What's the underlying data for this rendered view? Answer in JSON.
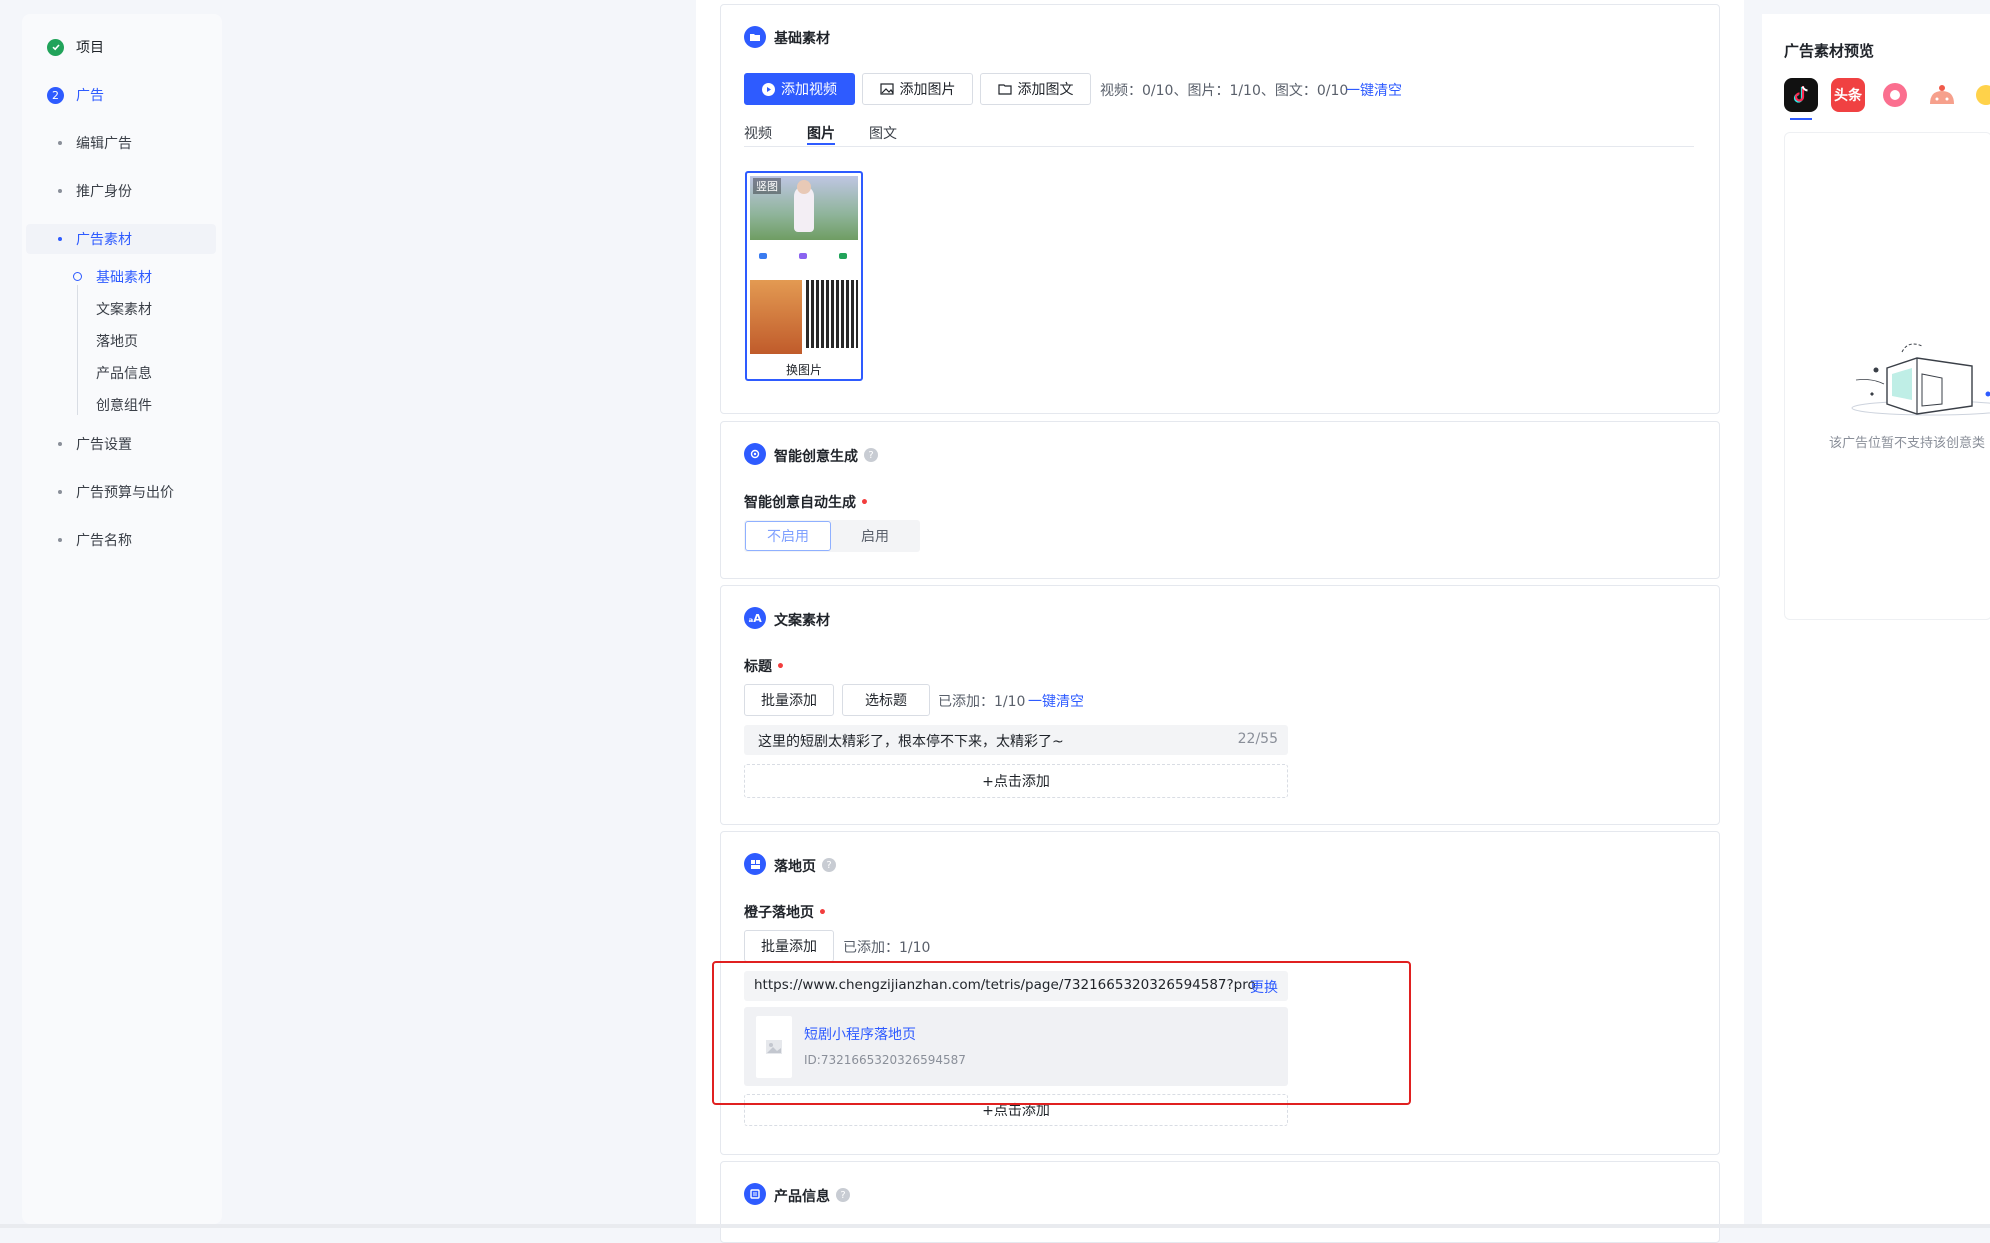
{
  "sidebar": {
    "steps": [
      {
        "label": "项目",
        "state": "done",
        "icon": "check-icon"
      },
      {
        "label": "广告",
        "state": "current",
        "number": "2"
      }
    ],
    "items": [
      {
        "label": "编辑广告"
      },
      {
        "label": "推广身份"
      },
      {
        "label": "广告素材",
        "active": true
      },
      {
        "label": "广告设置"
      },
      {
        "label": "广告预算与出价"
      },
      {
        "label": "广告名称"
      }
    ],
    "sub_items": [
      {
        "label": "基础素材",
        "active": true
      },
      {
        "label": "文案素材"
      },
      {
        "label": "落地页"
      },
      {
        "label": "产品信息"
      },
      {
        "label": "创意组件"
      }
    ]
  },
  "basic": {
    "title": "基础素材",
    "add_video": "添加视频",
    "add_image": "添加图片",
    "add_graphic": "添加图文",
    "counts": "视频：0/10、图片：1/10、图文：0/10",
    "clear": "一键清空",
    "tabs": [
      "视频",
      "图片",
      "图文"
    ],
    "active_tab": "图片",
    "thumb_tag": "竖图",
    "thumb_action": "换图片"
  },
  "smart": {
    "title": "智能创意生成",
    "field_label": "智能创意自动生成",
    "options": [
      "不启用",
      "启用"
    ],
    "selected": "不启用"
  },
  "copy": {
    "title": "文案素材",
    "field_label": "标题",
    "batch_add": "批量添加",
    "pick_title": "选标题",
    "added": "已添加：1/10",
    "clear": "一键清空",
    "title_text": "这里的短剧太精彩了，根本停不下来，太精彩了~",
    "title_count": "22/55",
    "add_more": "+点击添加"
  },
  "landing": {
    "title": "落地页",
    "field_label": "橙子落地页",
    "batch_add": "批量添加",
    "added": "已添加：1/10",
    "url": "https://www.chengzijianzhan.com/tetris/page/7321665320326594587?pro",
    "change": "更换",
    "page_name": "短剧小程序落地页",
    "page_id": "ID:7321665320326594587",
    "add_more": "+点击添加"
  },
  "product": {
    "title": "产品信息"
  },
  "preview": {
    "title": "广告素材预览",
    "apps": [
      {
        "icon": "douyin-icon",
        "label": "",
        "color": "#111111"
      },
      {
        "icon": "toutiao-icon",
        "label": "头条",
        "color": "#f04142"
      },
      {
        "icon": "pink-app-icon",
        "label": "",
        "color": "#fb6f8f"
      },
      {
        "icon": "fanqie-icon",
        "label": "",
        "color": "#f6a08c"
      },
      {
        "icon": "yellow-app-icon",
        "label": "",
        "color": "#ffd24a"
      }
    ],
    "empty_text": "该广告位暂不支持该创意类"
  },
  "colors": {
    "accent": "#2e5bff",
    "highlight_border": "#e02020",
    "required": "#f23d3d"
  }
}
